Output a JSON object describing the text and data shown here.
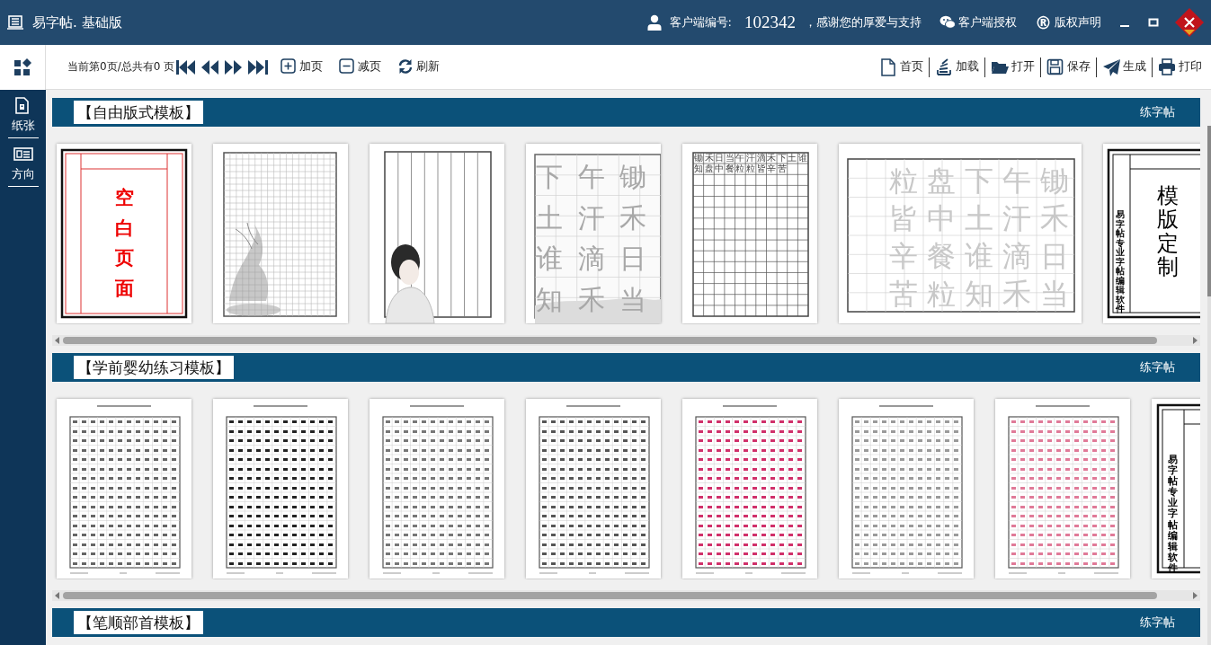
{
  "app": {
    "title": "易字帖. 基础版"
  },
  "header": {
    "customer_label": "客户端编号:",
    "customer_id": "102342",
    "thanks": "，感谢您的厚爱与支持",
    "links": [
      {
        "kind": "wechat",
        "label": "客户端授权"
      },
      {
        "kind": "registered",
        "icon": "®",
        "label": "版权声明"
      }
    ]
  },
  "sidebar": {
    "items": [
      {
        "kind": "paper",
        "label": "纸张"
      },
      {
        "kind": "orientation",
        "label": "方向"
      }
    ]
  },
  "toolbar": {
    "page_info": "当前第0页/总共有0 页",
    "left_buttons": [
      {
        "kind": "add",
        "label": "加页"
      },
      {
        "kind": "remove",
        "label": "减页"
      },
      {
        "kind": "refresh",
        "label": "刷新"
      }
    ],
    "right_buttons": [
      {
        "kind": "home",
        "label": "首页"
      },
      {
        "kind": "load",
        "label": "加载"
      },
      {
        "kind": "open",
        "label": "打开"
      },
      {
        "kind": "save",
        "label": "保存"
      },
      {
        "kind": "generate",
        "label": "生成"
      },
      {
        "kind": "print",
        "label": "打印"
      }
    ]
  },
  "sections": [
    {
      "title": "【自由版式模板】",
      "tag": "练字帖",
      "templates": [
        {
          "kind": "blank",
          "text": "空白页面"
        },
        {
          "kind": "grid-ink"
        },
        {
          "kind": "lines-figure"
        },
        {
          "kind": "trace-grid",
          "rows": [
            "下午锄",
            "土汗禾",
            "谁滴日",
            "知禾当"
          ]
        },
        {
          "kind": "small-grid",
          "rows": [
            "锄禾日当午汗滴禾下土谁",
            "知盘中餐粒粒皆辛苦"
          ]
        },
        {
          "kind": "trace-wide",
          "rows": [
            "粒盘下午锄",
            "皆中土汗禾",
            "辛餐谁滴日",
            "苦粒知禾当"
          ]
        },
        {
          "kind": "custom",
          "text": "模版定制",
          "side": "易字帖专业字帖编辑软件"
        }
      ]
    },
    {
      "title": "【学前婴幼练习模板】",
      "tag": "练字帖",
      "templates": [
        {
          "kind": "sheet",
          "color": "#666666"
        },
        {
          "kind": "sheet",
          "color": "#222222"
        },
        {
          "kind": "sheet",
          "color": "#777777"
        },
        {
          "kind": "sheet",
          "color": "#555555"
        },
        {
          "kind": "sheet",
          "color": "#d0306a"
        },
        {
          "kind": "sheet",
          "color": "#9a9a9a"
        },
        {
          "kind": "sheet",
          "color": "#e07a98"
        },
        {
          "kind": "custom-side",
          "side": "易字帖专业字帖编辑软件"
        }
      ]
    },
    {
      "title": "【笔顺部首模板】",
      "tag": "练字帖"
    }
  ]
}
